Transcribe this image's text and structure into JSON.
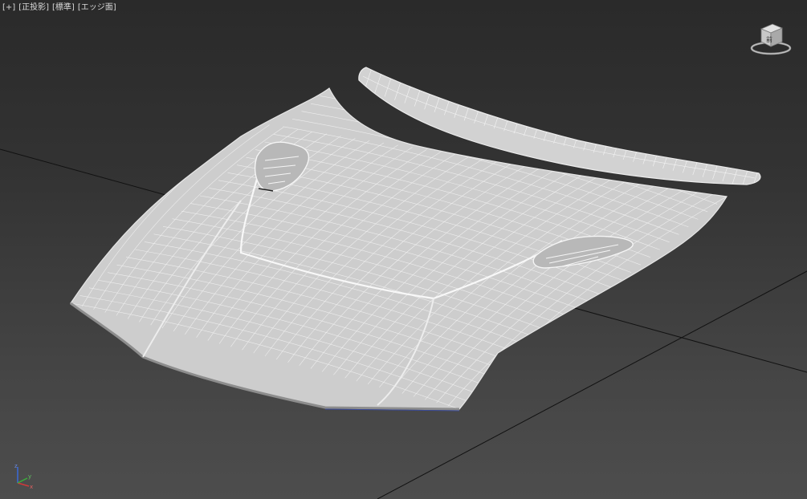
{
  "viewport": {
    "labels": {
      "plus": "[+]",
      "view": "[正投影]",
      "shading": "[標準]",
      "display": "[エッジ面]"
    }
  },
  "viewcube": {
    "icon": "viewcube-icon",
    "face_label": "前"
  },
  "axis_tripod": {
    "icon": "axis-tripod-icon",
    "x_label": "x",
    "y_label": "y",
    "z_label": "z",
    "colors": {
      "x": "#d03a3a",
      "y": "#3ab03a",
      "z": "#3a6ad8"
    }
  },
  "colors": {
    "background": "#3d3d3d",
    "grid_line": "#111111",
    "model_face": "#cfcfcf",
    "wire": "#f4f4f4"
  }
}
